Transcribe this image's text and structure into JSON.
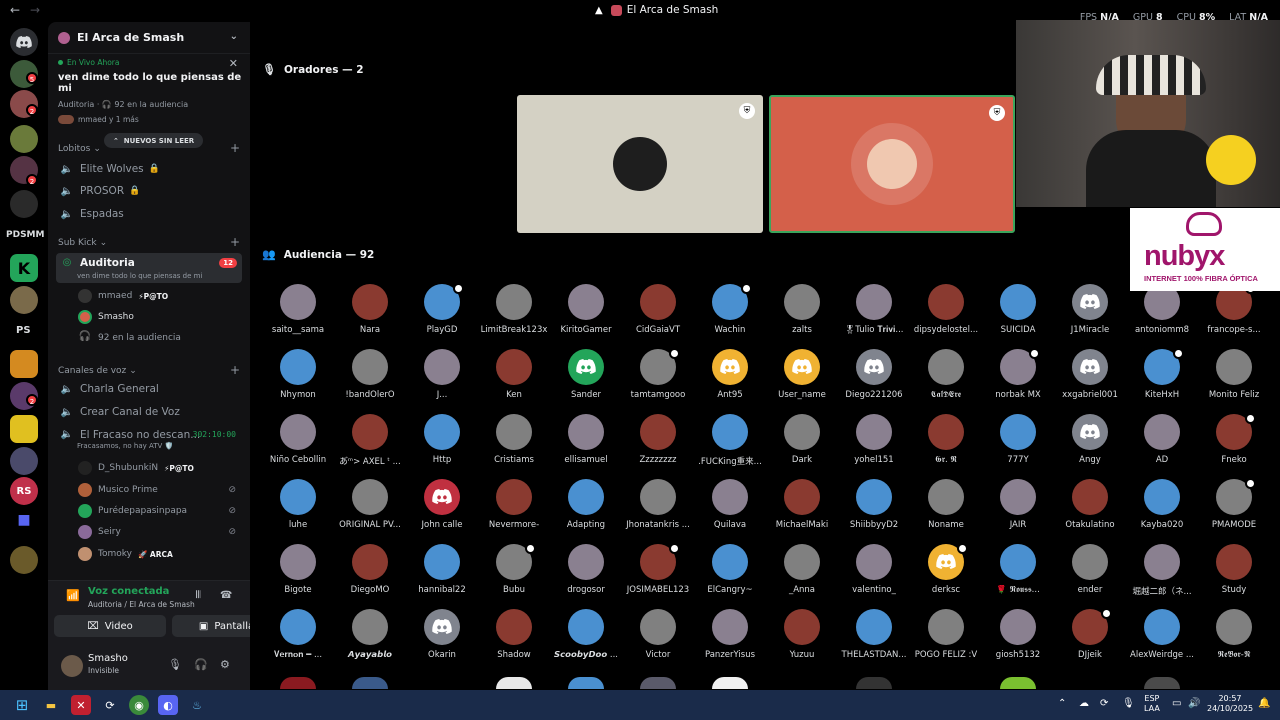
{
  "titlebar": {
    "title": "El Arca de Smash",
    "stats": [
      {
        "label": "FPS",
        "value": "N/A"
      },
      {
        "label": "GPU",
        "value": "8"
      },
      {
        "label": "CPU",
        "value": "8%"
      },
      {
        "label": "LAT",
        "value": "N/A"
      }
    ]
  },
  "servers": {
    "badges": [
      "5",
      "2",
      "2",
      "2"
    ],
    "text_icons": [
      "PS",
      "PS"
    ]
  },
  "guild": {
    "name": "El Arca de Smash",
    "live": {
      "tag": "En Vivo Ahora",
      "title": "ven dime todo lo que piensas de mi",
      "meta": "Auditoria · 🎧 92 en la audiencia",
      "users": "mmaed y 1 más"
    },
    "new_unread": "NUEVOS SIN LEER",
    "categories": [
      "Lobitos",
      "Sub Kick",
      "Canales de voz"
    ],
    "channels_lobitos": [
      "Elite Wolves",
      "PROSOR",
      "Espadas"
    ],
    "stage_channel": {
      "name": "Auditoria",
      "topic": "ven dime todo lo que piensas de mi",
      "count": "12"
    },
    "stage_users": [
      {
        "name": "mmaed",
        "tag": "⚡P@TO"
      },
      {
        "name": "Smasho",
        "tag": ""
      },
      {
        "name": "92 en la audiencia",
        "tag": ""
      }
    ],
    "voice_channels": [
      "Charla General",
      "Crear Canal de Voz"
    ],
    "fracaso": {
      "name": "El Fracaso no descan...",
      "timer": "302:10:00",
      "status": "Fracasamos, no hay ATV 🛡️"
    },
    "fracaso_users": [
      {
        "name": "D_ShubunkiN",
        "tag": "⚡P@TO"
      },
      {
        "name": "Musico Prime",
        "tag": ""
      },
      {
        "name": "Purédepapasinpapa",
        "tag": ""
      },
      {
        "name": "Seiry",
        "tag": ""
      },
      {
        "name": "Tomoky",
        "tag": "🚀 ARCA"
      }
    ]
  },
  "voice": {
    "status": "Voz conectada",
    "channel": "Auditoria / El Arca de Smash",
    "video": "Video",
    "screen": "Pantalla"
  },
  "user": {
    "name": "Smasho",
    "status": "Invisible"
  },
  "stage": {
    "speakers_header": "Oradores — 2",
    "audience_header": "Audiencia — 92",
    "speaker_colors": [
      "#d4d1c4",
      "#d4604a"
    ],
    "audience": [
      "saito__sama",
      "Nara",
      "PlayGD",
      "LimitBreak123x",
      "KiritoGamer",
      "CidGaiaVT",
      "Wachin",
      "zalts",
      "🎖Tulio 𝐓𝐫𝐢𝐯𝐢...",
      "dipsydelostel...",
      "SUICIDA",
      "J1Miracle",
      "antoniomm8",
      "francope-s...",
      "Nhymon",
      "!bandOlerO",
      "J...",
      "Ken",
      "Sander",
      "tamtamgooo",
      "Ant95",
      "User_name",
      "Diego221206",
      "𝕮𝖆𝖑𝕯𝕰𝖗𝖊",
      "norbak MX",
      "xxgabriel001",
      "KiteHxH",
      "Monito Feliz",
      "Niño Cebollin",
      "あ゙ᵐ> AXEL ᵗ ...",
      "Http",
      "Cristiams",
      "ellisamuel",
      "Zzzzzzzz",
      ".FUCKing重来...",
      "Dark",
      "yohel151",
      "𝕲𝖗. 𝕽",
      "777Y",
      "Angy",
      "AD",
      "Fneko",
      "luhe",
      "ORIGINAL PV...",
      "John calle",
      "Nevermore-",
      "Adapting",
      "Jhonatankris ...",
      "Quilava",
      "MichaelMaki",
      "ShiibbyyD2",
      "Noname",
      "JAIR",
      "Otakulatino",
      "Kayba020",
      "PMAMODE",
      "Bigote",
      "DiegoMO",
      "hannibal22",
      "Bubu",
      "drogosor",
      "JOSIMABEL123",
      "ElCangry~",
      "_Anna",
      "valentino_",
      "derksc",
      "🌹 𝕹𝖔𝖚𝖘𝖘...",
      "ender",
      "堀越二郎（ネ...",
      "Study",
      "𝐕𝐞𝐫𝐧𝐨𝐧 ━ ...",
      "𝘼𝙮𝙖𝙮𝙖𝙗𝙡𝙤",
      "Okarin",
      "Shadow",
      "𝙎𝙘𝙤𝙤𝙗𝙮𝘿𝙤𝙤 ...",
      "Victor",
      "PanzerYisus",
      "Yuzuu",
      "THELASTDAN...",
      "POGO FELIZ :V",
      "giosh5132",
      "DJjeik",
      "AlexWeirdge ...",
      "𝕽𝖊𝕭𝖔𝖗-𝕹"
    ]
  },
  "sponsor": {
    "brand": "nubyx",
    "tagline": "INTERNET 100% FIBRA ÓPTICA"
  },
  "taskbar": {
    "lang": "ESP",
    "layout": "LAA",
    "time": "20:57",
    "date": "24/10/2025"
  }
}
